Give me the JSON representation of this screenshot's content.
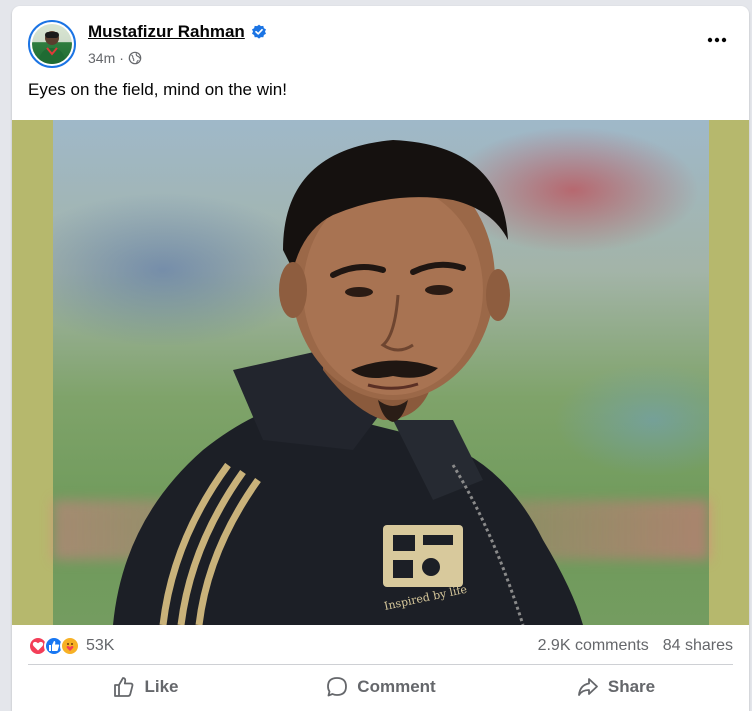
{
  "post": {
    "author": "Mustafizur Rahman",
    "time": "34m",
    "separator": "·",
    "caption": "Eyes on the field, mind on the win!",
    "avatar_icon": "avatar-photo",
    "verified_icon": "verified-badge-icon",
    "privacy_icon": "globe-icon",
    "jacket_text": "Inspired by life"
  },
  "stats": {
    "reactions": [
      "love",
      "like",
      "care"
    ],
    "reaction_count": "53K",
    "comments": "2.9K comments",
    "shares": "84 shares"
  },
  "actions": {
    "like": "Like",
    "comment": "Comment",
    "share": "Share"
  },
  "colors": {
    "verified": "#1b74e4",
    "love": "#f33e58",
    "like": "#1877f2",
    "care": "#f7b125",
    "muted": "#65676b",
    "photo_border": "#b6b86d"
  }
}
